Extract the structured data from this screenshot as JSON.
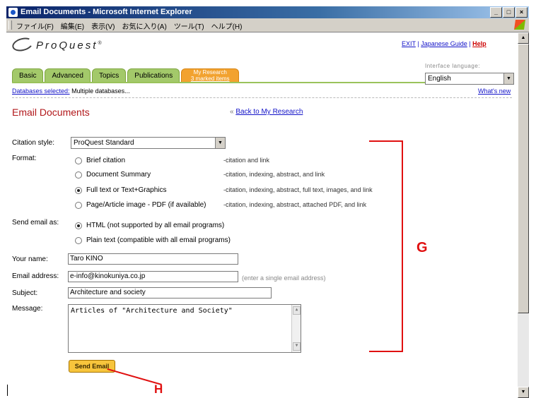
{
  "window": {
    "title": "Email Documents - Microsoft Internet Explorer",
    "buttons": [
      "_",
      "□",
      "×"
    ]
  },
  "menubar": {
    "items": [
      "ファイル(F)",
      "編集(E)",
      "表示(V)",
      "お気に入り(A)",
      "ツール(T)",
      "ヘルプ(H)"
    ]
  },
  "header": {
    "logo_text": "ProQuest",
    "exit_link": "EXIT",
    "separator": "|",
    "japanese_link": "Japanese Guide",
    "help_link": "Help"
  },
  "tabs": [
    {
      "label": "Basic"
    },
    {
      "label": "Advanced"
    },
    {
      "label": "Topics"
    },
    {
      "label": "Publications"
    }
  ],
  "my_research_tab": {
    "line1": "My Research",
    "line2": "3 marked items"
  },
  "interface_language": {
    "label": "Interface language:",
    "value": "English"
  },
  "databases": {
    "link": "Databases selected:",
    "value": "Multiple databases..."
  },
  "whats_new": "What's new",
  "page_title": "Email Documents",
  "back_link": {
    "prefix": "«",
    "label": "Back to My Research"
  },
  "form": {
    "citation_style": {
      "label": "Citation style:",
      "value": "ProQuest Standard"
    },
    "format": {
      "label": "Format:",
      "options": [
        {
          "label": "Brief citation",
          "desc": "-citation and link",
          "selected": false
        },
        {
          "label": "Document Summary",
          "desc": "-citation, indexing, abstract, and link",
          "selected": false
        },
        {
          "label": "Full text or Text+Graphics",
          "desc": "-citation, indexing, abstract, full text, images, and link",
          "selected": true
        },
        {
          "label": "Page/Article image - PDF (if available)",
          "desc": "-citation, indexing, abstract, attached PDF, and link",
          "selected": false
        }
      ]
    },
    "send_as": {
      "label": "Send email as:",
      "options": [
        {
          "label": "HTML (not supported by all email programs)",
          "selected": true
        },
        {
          "label": "Plain text (compatible with all email programs)",
          "selected": false
        }
      ]
    },
    "your_name": {
      "label": "Your name:",
      "value": "Taro KINO"
    },
    "email": {
      "label": "Email address:",
      "value": "e-info@kinokuniya.co.jp",
      "hint": "(enter a single email address)"
    },
    "subject": {
      "label": "Subject:",
      "value": "Architecture and society"
    },
    "message": {
      "label": "Message:",
      "value": "Articles of \"Architecture and Society\""
    },
    "send_button": "Send Email"
  },
  "annotations": {
    "g": "G",
    "h": "H"
  },
  "colors": {
    "accent_red": "#e01010",
    "heading_red": "#b2181b",
    "tab_green": "#a3c96a",
    "tab_orange": "#f2a22f",
    "link_blue": "#1212c8"
  }
}
